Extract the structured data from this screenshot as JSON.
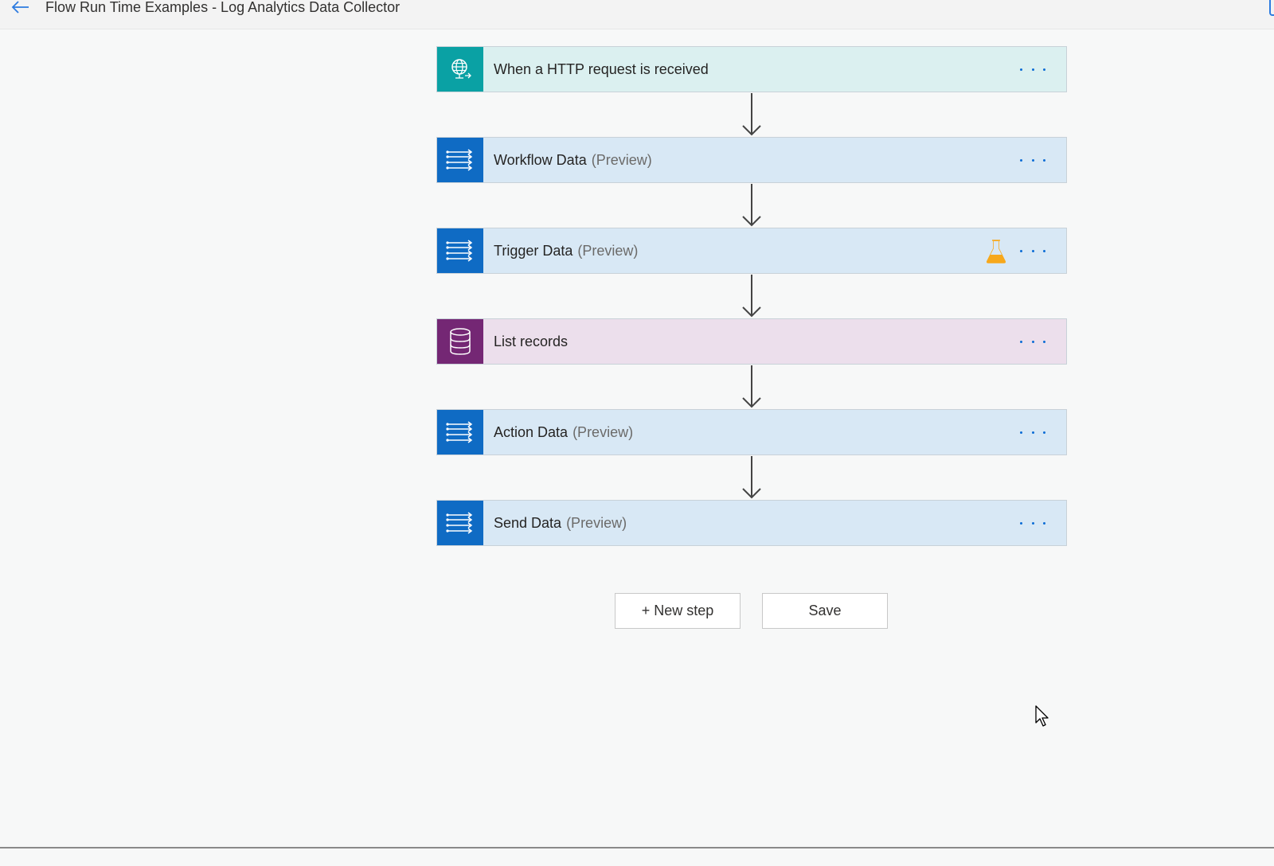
{
  "header": {
    "title": "Flow Run Time Examples - Log Analytics Data Collector",
    "back_icon": "back-arrow-icon"
  },
  "steps": [
    {
      "label": "When a HTTP request is received",
      "suffix": "",
      "icon": "http-globe-icon",
      "color": "#0aa1a4"
    },
    {
      "label": "Workflow Data",
      "suffix": "(Preview)",
      "icon": "data-stream-icon",
      "color": "#0f6bc4"
    },
    {
      "label": "Trigger Data",
      "suffix": "(Preview)",
      "icon": "data-stream-icon",
      "color": "#0f6bc4",
      "badge_icon": "flask-icon",
      "badge_color": "#f7a81b"
    },
    {
      "label": "List records",
      "suffix": "",
      "icon": "database-icon",
      "color": "#742774"
    },
    {
      "label": "Action Data",
      "suffix": "(Preview)",
      "icon": "data-stream-icon",
      "color": "#0f6bc4"
    },
    {
      "label": "Send Data",
      "suffix": "(Preview)",
      "icon": "data-stream-icon",
      "color": "#0f6bc4"
    }
  ],
  "actions": {
    "new_step_label": "+ New step",
    "save_label": "Save"
  },
  "colors": {
    "accent": "#0b6cd5",
    "canvas": "#f7f8f8"
  }
}
